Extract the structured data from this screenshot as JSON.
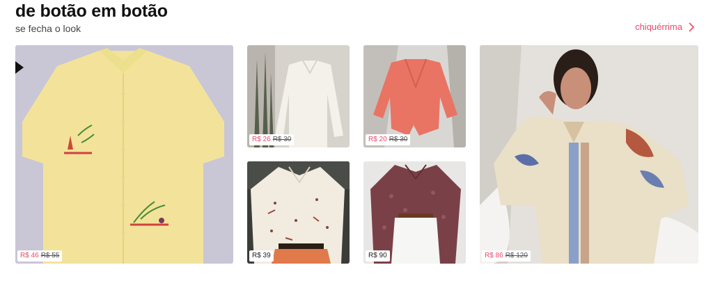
{
  "header": {
    "title": "de botão em botão",
    "subtitle": "se fecha o look",
    "link_label": "chiquérrima"
  },
  "colors": {
    "accent": "#e84a6a"
  },
  "icons": {
    "link_chevron": "chevron-right-icon",
    "carousel_prev": "arrow-left-icon"
  },
  "products": [
    {
      "price": "R$ 46",
      "old_price": "R$ 55"
    },
    {
      "price": "R$ 26",
      "old_price": "R$ 30"
    },
    {
      "price": "R$ 20",
      "old_price": "R$ 30"
    },
    {
      "price": "R$ 86",
      "old_price": "R$ 120"
    },
    {
      "price": "R$ 39",
      "old_price": ""
    },
    {
      "price": "R$ 90",
      "old_price": ""
    }
  ]
}
